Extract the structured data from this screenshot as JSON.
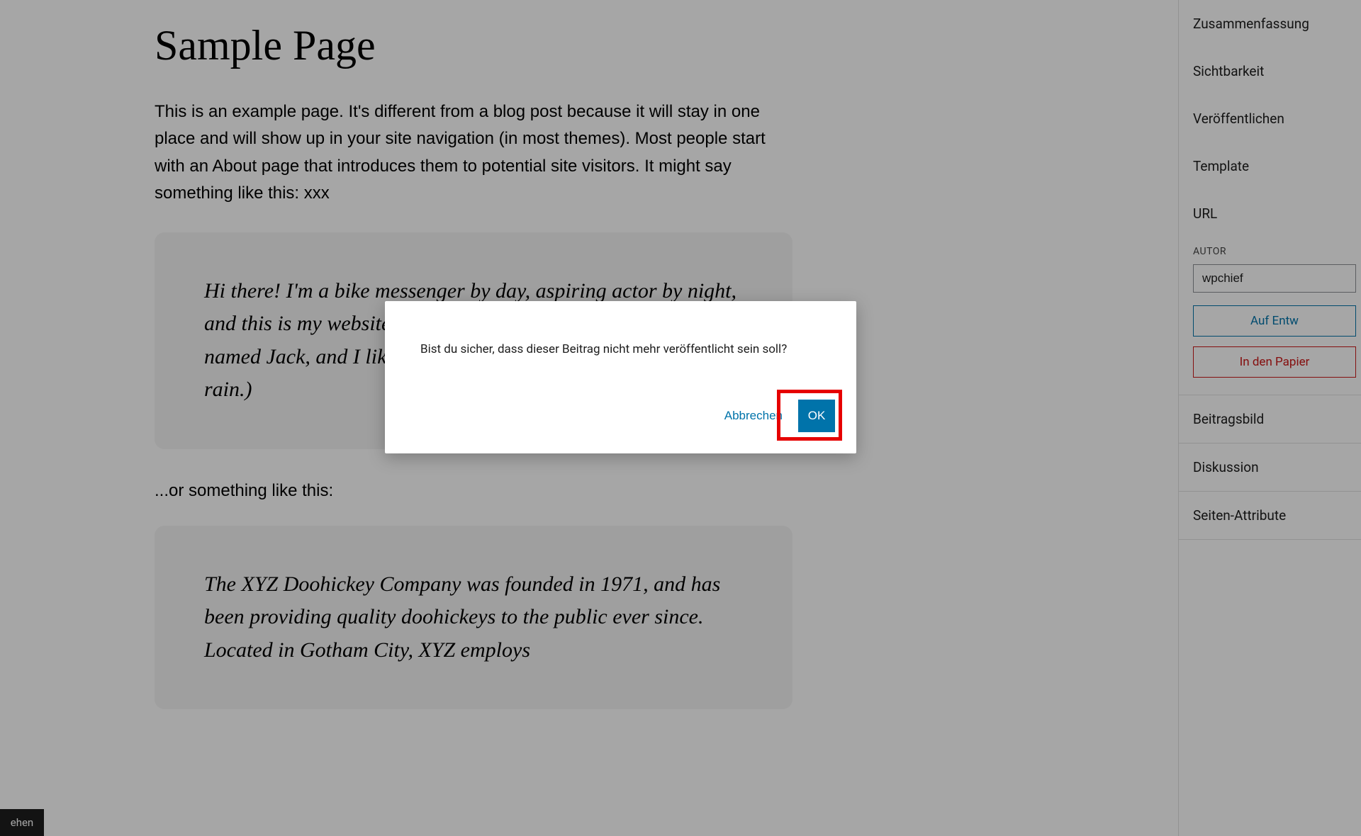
{
  "page": {
    "title": "Sample Page",
    "intro": "This is an example page. It's different from a blog post because it will stay in one place and will show up in your site navigation (in most themes). Most people start with an About page that introduces them to potential site visitors. It might say something like this: xxx",
    "quote1": "Hi there! I'm a bike messenger by day, aspiring actor by night, and this is my website. I live in Los Angeles, have a great dog named Jack, and I like piña coladas. (And gettin' caught in the rain.)",
    "mid": "...or something like this:",
    "quote2": "The XYZ Doohickey Company was founded in 1971, and has been providing quality doohickeys to the public ever since. Located in Gotham City, XYZ employs"
  },
  "sidebar": {
    "summary": "Zusammenfassung",
    "visibility": "Sichtbarkeit",
    "publish": "Veröffentlichen",
    "template": "Template",
    "url": "URL",
    "author_label": "AUTOR",
    "author_value": "wpchief",
    "draft_button": "Auf Entw",
    "trash_button": "In den Papier",
    "featured_image": "Beitragsbild",
    "discussion": "Diskussion",
    "page_attributes": "Seiten-Attribute"
  },
  "dialog": {
    "message": "Bist du sicher, dass dieser Beitrag nicht mehr veröffentlicht sein soll?",
    "cancel": "Abbrechen",
    "ok": "OK"
  },
  "bottom_tab": "ehen"
}
